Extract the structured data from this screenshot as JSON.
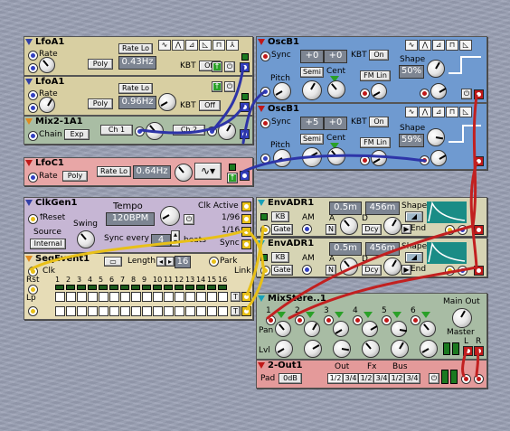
{
  "modules": {
    "lfoa1_top": {
      "title": "LfoA1",
      "rate_label": "Rate",
      "poly": "Poly",
      "rate_lo": "Rate Lo",
      "freq": "0.43Hz",
      "kbt_label": "KBT",
      "kbt": "Off"
    },
    "lfoa1_bot": {
      "title": "LfoA1",
      "rate_label": "Rate",
      "poly": "Poly",
      "rate_lo": "Rate Lo",
      "freq": "0.96Hz",
      "kbt_label": "KBT",
      "kbt": "Off"
    },
    "mix2": {
      "title": "Mix2-1A1",
      "chain": "Chain",
      "exp": "Exp",
      "ch1": "Ch 1",
      "ch2": "Ch 2"
    },
    "lfoc1": {
      "title": "LfoC1",
      "rate_label": "Rate",
      "poly": "Poly",
      "rate_lo": "Rate Lo",
      "freq": "0.64Hz"
    },
    "oscb1_top": {
      "title": "OscB1",
      "sync": "Sync",
      "val1": "+0",
      "val2": "+0",
      "kbt": "KBT",
      "on": "On",
      "semi": "Semi",
      "cent": "Cent",
      "fmlin": "FM Lin",
      "pitch": "Pitch",
      "shape_label": "Shape",
      "shape": "50%"
    },
    "oscb1_bot": {
      "title": "OscB1",
      "sync": "Sync",
      "val1": "+5",
      "val2": "+0",
      "kbt": "KBT",
      "on": "On",
      "semi": "Semi",
      "cent": "Cent",
      "fmlin": "FM Lin",
      "pitch": "Pitch",
      "shape_label": "Shape",
      "shape": "59%"
    },
    "clkgen": {
      "title": "ClkGen1",
      "tempo_label": "Tempo",
      "tempo": "120BPM",
      "clk_active": "Clk Active",
      "reset": "Reset",
      "swing": "Swing",
      "source_label": "Source",
      "source": "Internal",
      "sync_every": "Sync every",
      "sync_val": "4",
      "beats": "beats",
      "r96": "1/96",
      "r16": "1/16",
      "sync": "Sync"
    },
    "envadr_top": {
      "title": "EnvADR1",
      "attack": "0.5m",
      "decay": "456m",
      "shape": "Shape",
      "kb": "KB",
      "am": "AM",
      "a": "A",
      "d": "D",
      "gate": "Gate",
      "n": "N",
      "dcy": "Dcy",
      "end": "End"
    },
    "envadr_bot": {
      "title": "EnvADR1",
      "attack": "0.5m",
      "decay": "456m",
      "shape": "Shape",
      "kb": "KB",
      "am": "AM",
      "a": "A",
      "d": "D",
      "gate": "Gate",
      "n": "N",
      "dcy": "Dcy",
      "end": "End"
    },
    "seqevent": {
      "title": "SeqEvent1",
      "length_label": "Length",
      "length": "16",
      "park": "Park",
      "clk": "Clk",
      "rst": "Rst",
      "link": "Link",
      "lp": "Lp",
      "steps": [
        "1",
        "2",
        "3",
        "4",
        "5",
        "6",
        "7",
        "8",
        "9",
        "10",
        "11",
        "12",
        "13",
        "14",
        "15",
        "16"
      ],
      "t": "T"
    },
    "mixstereo": {
      "title": "MixStere..1",
      "main_out": "Main Out",
      "pan": "Pan",
      "lvl": "Lvl",
      "master": "Master",
      "ch": [
        "1",
        "2",
        "3",
        "4",
        "5",
        "6"
      ],
      "l": "L",
      "r": "R"
    },
    "out2": {
      "title": "2-Out1",
      "pad": "Pad",
      "db": "0dB",
      "out_label": "Out",
      "fx_label": "Fx",
      "bus_label": "Bus",
      "o12": "1/2",
      "o34": "3/4",
      "f12": "1/2",
      "f34": "3/4",
      "b12": "1/2",
      "b34": "3/4"
    }
  },
  "colors": {
    "lfo": "#d8cfa2",
    "osc": "#6f9ad0",
    "mix2": "#a9bda4",
    "lfoc": "#e8a6a6",
    "clk": "#c6b6d4",
    "env": "#d6d4b4",
    "seq": "#e6dcb6",
    "mixs": "#a8bca4",
    "out": "#e49a9a",
    "cable_red": "#c22020",
    "cable_blue": "#2d34a8",
    "cable_yellow": "#e8c018"
  }
}
